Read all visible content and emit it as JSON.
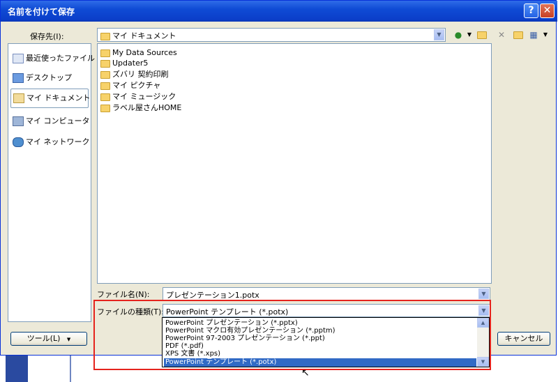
{
  "window": {
    "title": "名前を付けて保存",
    "help_label": "?",
    "close_label": "✕"
  },
  "toolbar": {
    "save_in_label": "保存先(I):",
    "location": "マイ ドキュメント",
    "icons": [
      "back-icon",
      "up-folder-icon",
      "delete-icon",
      "new-folder-icon",
      "views-icon"
    ]
  },
  "places": [
    {
      "label": "最近使ったファイル",
      "icon": "recent-icon"
    },
    {
      "label": "デスクトップ",
      "icon": "desktop-icon"
    },
    {
      "label": "マイ ドキュメント",
      "icon": "documents-icon",
      "selected": true
    },
    {
      "label": "マイ コンピュータ",
      "icon": "computer-icon"
    },
    {
      "label": "マイ ネットワーク",
      "icon": "network-icon"
    }
  ],
  "files": [
    "My Data Sources",
    "Updater5",
    "ズバリ 契約印刷",
    "マイ ピクチャ",
    "マイ ミュージック",
    "ラベル屋さんHOME"
  ],
  "filename": {
    "label": "ファイル名(N):",
    "value": "プレゼンテーション1.potx"
  },
  "filetype": {
    "label": "ファイルの種類(T):",
    "value": "PowerPoint テンプレート (*.potx)",
    "options": [
      "PowerPoint プレゼンテーション (*.pptx)",
      "PowerPoint マクロ有効プレゼンテーション (*.pptm)",
      "PowerPoint 97-2003 プレゼンテーション (*.ppt)",
      "PDF (*.pdf)",
      "XPS 文書 (*.xps)",
      "PowerPoint テンプレート (*.potx)"
    ],
    "selected_index": 5
  },
  "buttons": {
    "tools": "ツール(L)",
    "cancel": "キャンセル"
  }
}
